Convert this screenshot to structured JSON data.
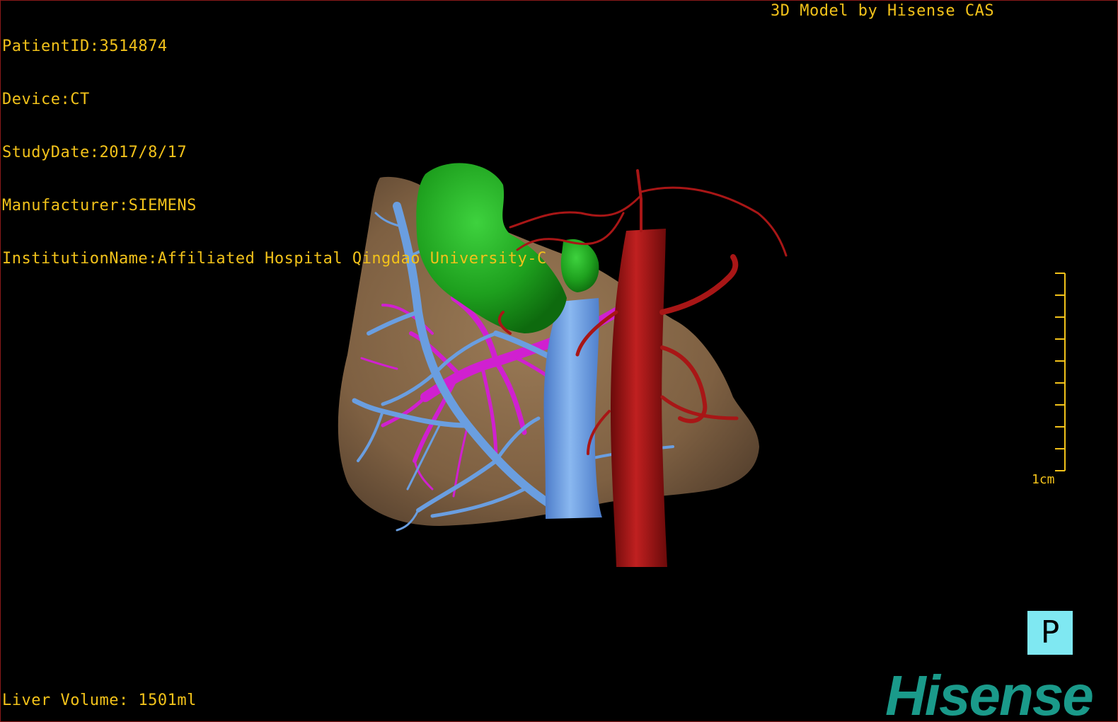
{
  "patient": {
    "patient_id": "PatientID:3514874",
    "device": "Device:CT",
    "study_date": "StudyDate:2017/8/17",
    "manufacturer": "Manufacturer:SIEMENS",
    "institution": "InstitutionName:Affiliated Hospital Qingdao University-C"
  },
  "header_right": "3D Model by Hisense CAS",
  "liver_volume": "Liver Volume: 1501ml",
  "scale_bar": {
    "label": "1cm"
  },
  "orientation_button": {
    "label": "P"
  },
  "logo_text": "Hisense",
  "colors": {
    "overlay_text": "#f2c21a",
    "liver": "#8a6a48",
    "aorta": "#a81616",
    "portal_vein": "#6a9ee0",
    "hepatic_vein": "#d020d0",
    "gallbladder_stomach": "#1ea01e",
    "orientation_bg": "#7fe8f2",
    "logo": "#1a9a8a"
  }
}
